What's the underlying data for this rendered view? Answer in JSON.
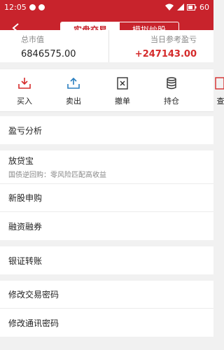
{
  "status_bar": {
    "time": "12:05",
    "battery": "60"
  },
  "header": {
    "tabs": [
      {
        "label": "实盘交易",
        "active": true
      },
      {
        "label": "模拟炒股",
        "active": false
      }
    ]
  },
  "summary": {
    "total_value_label": "总市值",
    "total_value": "6846575.00",
    "today_profit_label": "当日参考盈亏",
    "today_profit": "+247143.00"
  },
  "actions": [
    {
      "label": "买入",
      "icon": "buy-icon"
    },
    {
      "label": "卖出",
      "icon": "sell-icon"
    },
    {
      "label": "撤单",
      "icon": "cancel-order-icon"
    },
    {
      "label": "持仓",
      "icon": "holdings-icon"
    },
    {
      "label": "查",
      "icon": "query-icon"
    }
  ],
  "menu": {
    "profit_analysis": "盈亏分析",
    "fangdaibao": {
      "title": "放贷宝",
      "subtitle": "国债逆回购：零风险匹配高收益"
    },
    "ipo_subscribe": "新股申购",
    "margin_trading": "融资融券",
    "bank_transfer": "银证转账",
    "change_trade_password": "修改交易密码",
    "change_comm_password": "修改通讯密码"
  },
  "colors": {
    "brand": "#c8232c",
    "profit": "#d52b2b"
  }
}
